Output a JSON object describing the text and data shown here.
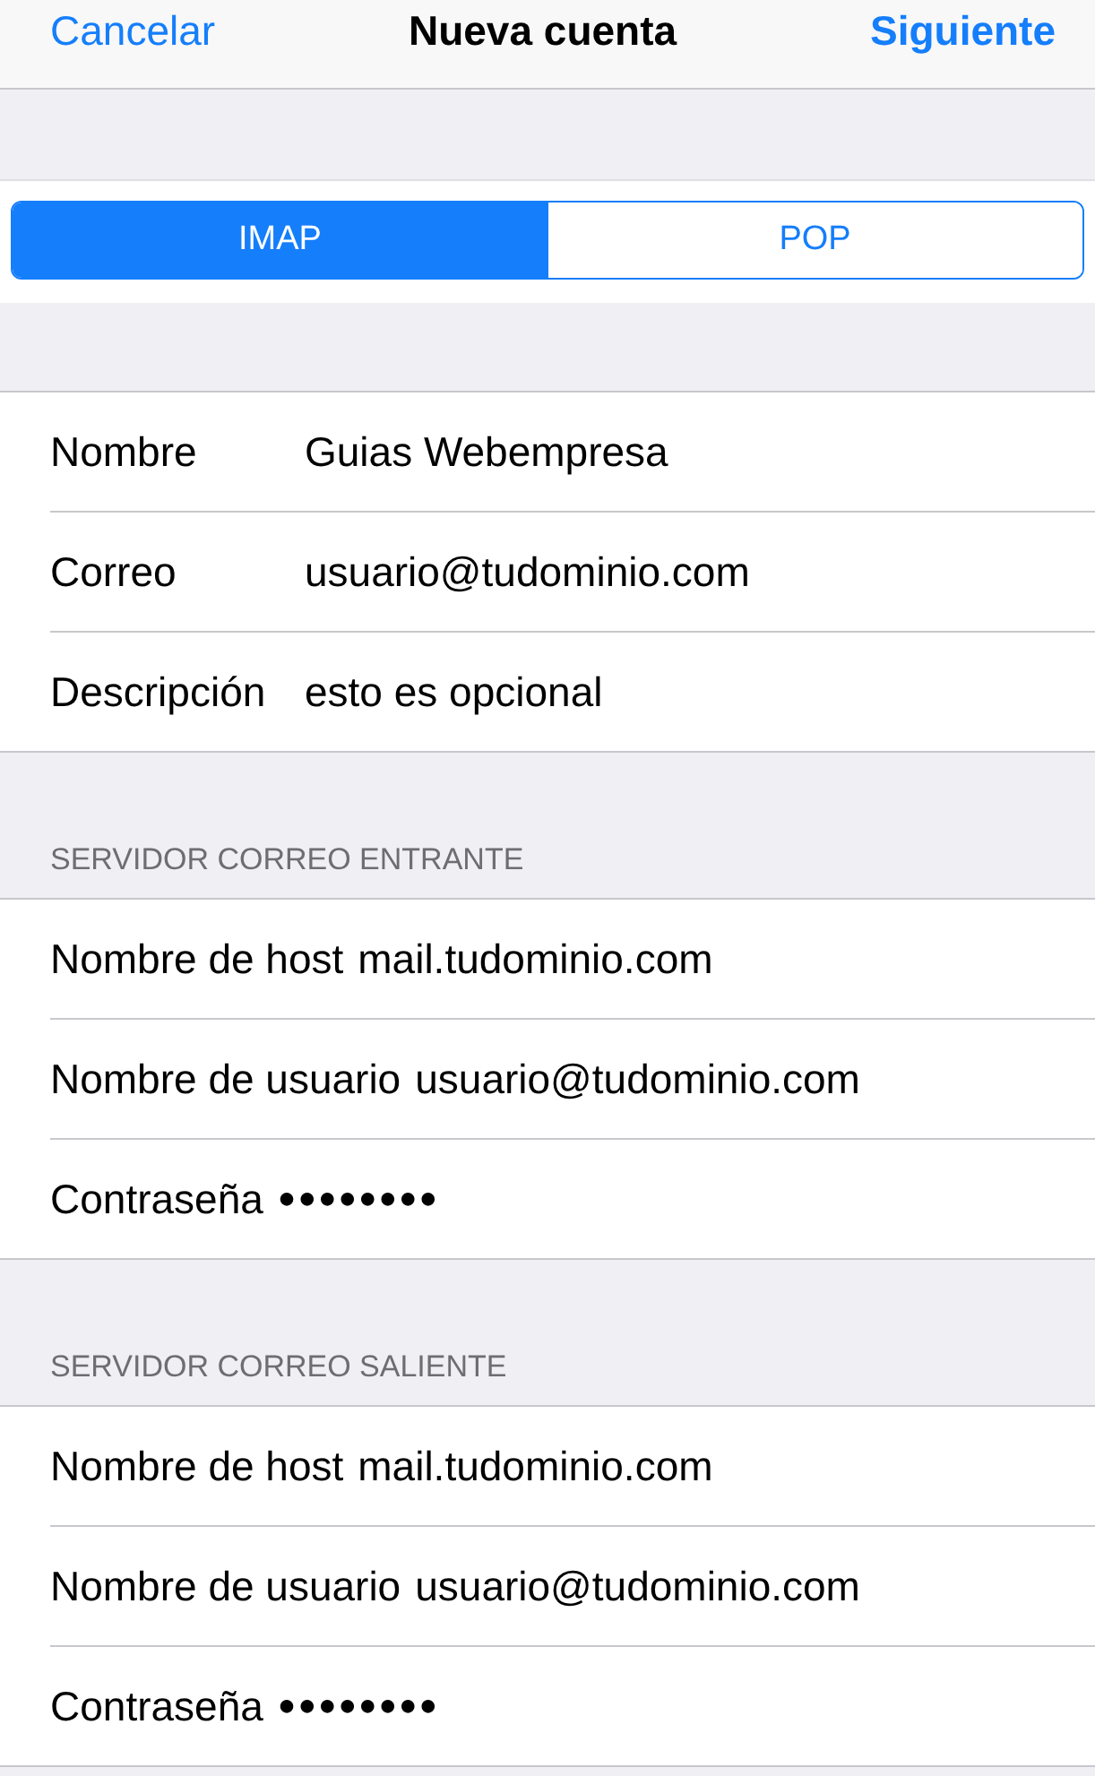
{
  "nav_bar": {
    "cancel": "Cancelar",
    "title": "Nueva cuenta",
    "next": "Siguiente"
  },
  "segments": [
    {
      "label": "IMAP",
      "selected": true
    },
    {
      "label": "POP",
      "selected": false
    }
  ],
  "sections": [
    {
      "kind": "aligned",
      "rows": [
        {
          "label": "Nombre",
          "value": "Guias Webempresa"
        },
        {
          "label": "Correo",
          "value": "usuario@tudominio.com"
        },
        {
          "label": "Descripción",
          "value": "esto es opcional"
        }
      ]
    },
    {
      "kind": "inline",
      "header": "SERVIDOR CORREO ENTRANTE",
      "rows": [
        {
          "label": "Nombre de host",
          "value": "mail.tudominio.com"
        },
        {
          "label": "Nombre de usuario",
          "value": "usuario@tudominio.com"
        },
        {
          "label": "Contraseña",
          "value": "●●●●●●●●"
        }
      ]
    },
    {
      "kind": "inline",
      "header": "SERVIDOR CORREO SALIENTE",
      "rows": [
        {
          "label": "Nombre de host",
          "value": "mail.tudominio.com"
        },
        {
          "label": "Nombre de usuario",
          "value": "usuario@tudominio.com"
        },
        {
          "label": "Contraseña",
          "value": "●●●●●●●●"
        }
      ]
    }
  ]
}
